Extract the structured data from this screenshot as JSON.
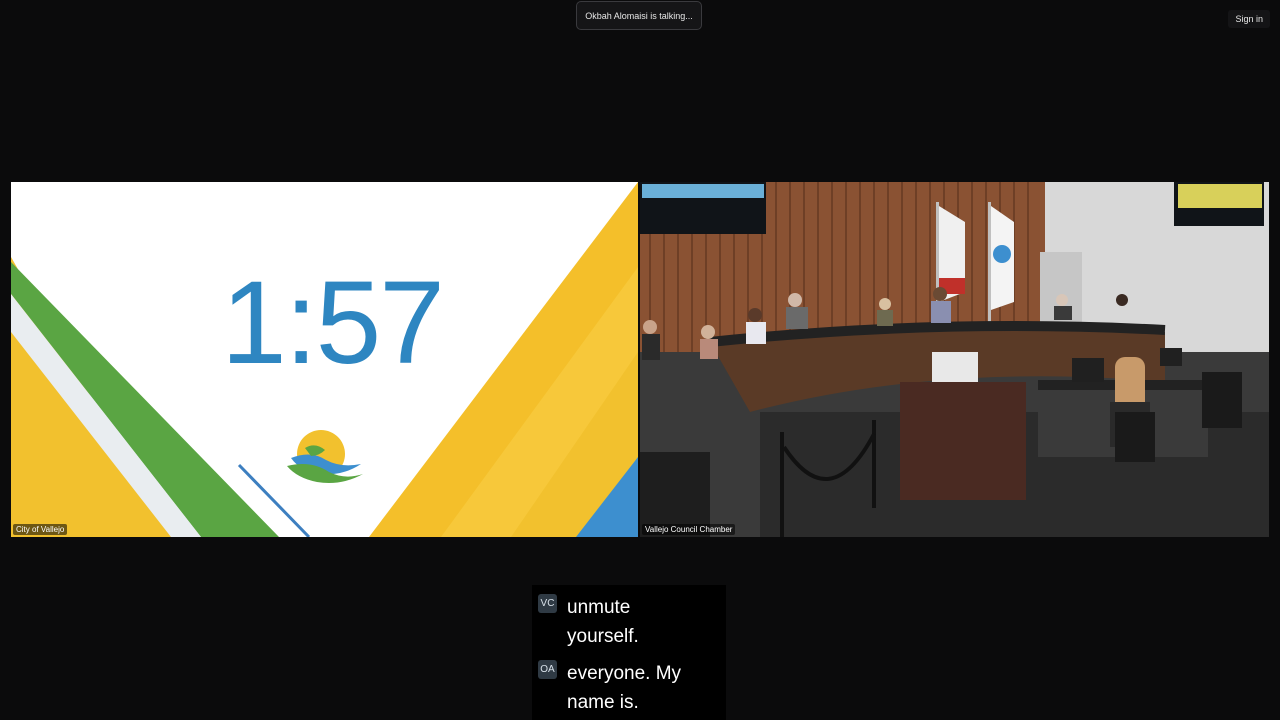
{
  "status": {
    "talking": "Okbah Alomaisi is talking..."
  },
  "header": {
    "sign_in": "Sign in"
  },
  "tiles": {
    "left": {
      "label": "City of Vallejo",
      "timer": "1:57"
    },
    "right": {
      "label": "Vallejo Council Chamber"
    }
  },
  "captions": [
    {
      "initials": "VC",
      "text": "unmute yourself."
    },
    {
      "initials": "OA",
      "text": "everyone. My name is."
    }
  ],
  "colors": {
    "timer": "#2e86c1",
    "green": "#5aa543",
    "yellow": "#f2c12e",
    "blue": "#3d8fcf"
  }
}
